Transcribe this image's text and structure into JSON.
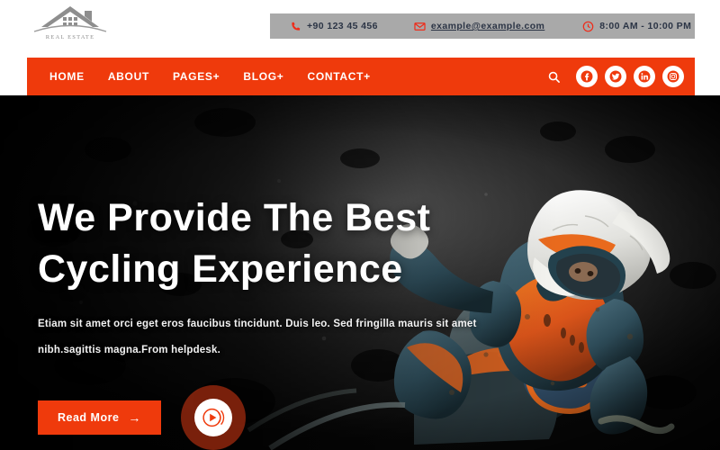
{
  "brand": {
    "logo_icon": "house-roof-icon",
    "logo_text": "REAL ESTATE"
  },
  "topbar": {
    "contact": [
      {
        "icon": "phone-icon",
        "text": "+90 123 45 456"
      },
      {
        "icon": "mail-icon",
        "text": "example@example.com"
      },
      {
        "icon": "clock-icon",
        "text": "8:00 AM - 10:00 PM"
      }
    ],
    "bar_color": "#a9a9a9",
    "text_color": "#2b3445"
  },
  "nav": {
    "accent_color": "#ef3a0c",
    "items": [
      {
        "label": "HOME",
        "has_caret": false
      },
      {
        "label": "ABOUT",
        "has_caret": false
      },
      {
        "label": "PAGES+",
        "has_caret": true
      },
      {
        "label": "BLOG+",
        "has_caret": true
      },
      {
        "label": "CONTACT+",
        "has_caret": true
      }
    ],
    "search_icon": "search-icon",
    "social": [
      {
        "name": "facebook-icon",
        "label": "Facebook"
      },
      {
        "name": "twitter-icon",
        "label": "Twitter"
      },
      {
        "name": "linkedin-icon",
        "label": "LinkedIn"
      },
      {
        "name": "instagram-icon",
        "label": "Instagram"
      }
    ]
  },
  "hero": {
    "title_line1": "We Provide The Best",
    "title_line2": "Cycling Experience",
    "paragraph": "Etiam sit amet orci eget eros faucibus tincidunt. Duis leo. Sed fringilla mauris sit amet nibh.sagittis magna.From helpdesk.",
    "cta_label": "Read More",
    "cta_arrow": "→",
    "play_icon": "play-button-icon",
    "background": "motocross-rider-dark-photo"
  }
}
